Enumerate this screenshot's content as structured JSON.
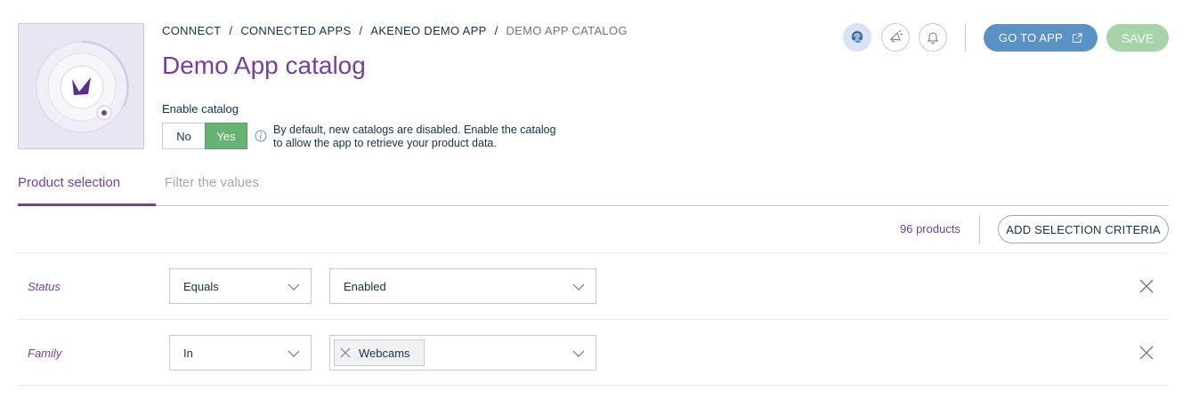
{
  "breadcrumb": [
    {
      "label": "CONNECT"
    },
    {
      "label": "CONNECTED APPS"
    },
    {
      "label": "AKENEO DEMO APP"
    },
    {
      "label": "DEMO APP CATALOG"
    }
  ],
  "breadcrumb_separator": "/",
  "page_title": "Demo App catalog",
  "enable_catalog": {
    "label": "Enable catalog",
    "no_label": "No",
    "yes_label": "Yes",
    "selected": "Yes",
    "help": "By default, new catalogs are disabled. Enable the catalog to allow the app to retrieve your product data."
  },
  "header_actions": {
    "help_icon": "help-center-icon",
    "announcements_icon": "megaphone-icon",
    "notifications_icon": "bell-icon",
    "go_to_app_label": "GO TO APP",
    "save_label": "SAVE"
  },
  "tabs": [
    {
      "label": "Product selection",
      "active": true
    },
    {
      "label": "Filter the values",
      "active": false
    }
  ],
  "toolbar": {
    "count": "96 products",
    "add_criteria_label": "ADD SELECTION CRITERIA"
  },
  "criteria": [
    {
      "field": "Status",
      "operator": "Equals",
      "value": "Enabled"
    },
    {
      "field": "Family",
      "operator": "In",
      "chips": [
        "Webcams"
      ]
    }
  ],
  "colors": {
    "brand_purple": "#763e9e",
    "primary_blue": "#5992c7",
    "success_green": "#67b373",
    "save_disabled": "#a6d4a8",
    "border_grey": "#c7cbd4"
  }
}
